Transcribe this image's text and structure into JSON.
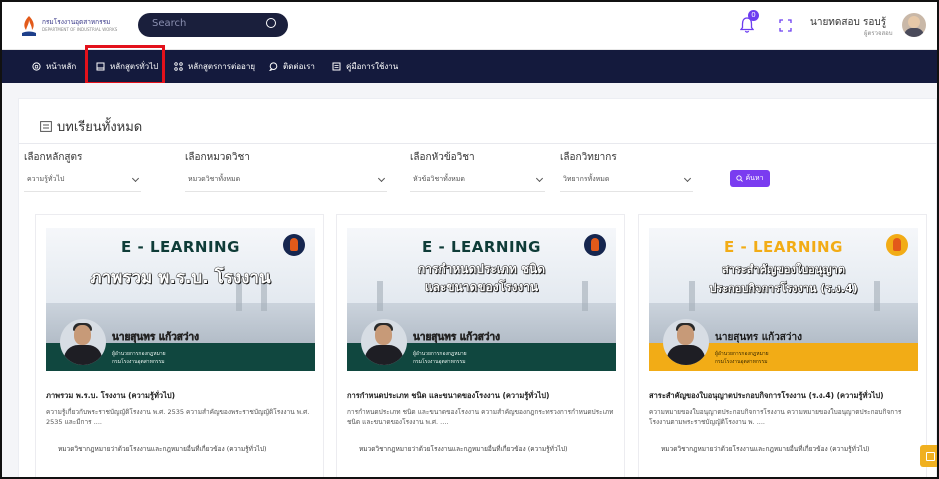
{
  "header": {
    "logo_line1": "กรมโรงงานอุตสาหกรรม",
    "logo_line2": "DEPARTMENT OF INDUSTRIAL WORKS",
    "search_placeholder": "Search",
    "notification_count": "0",
    "user_name": "นายทดสอบ รอบรู้",
    "user_role": "ผู้ตรวจสอบ"
  },
  "nav": {
    "items": [
      {
        "label": "หน้าหลัก",
        "icon": "home-icon"
      },
      {
        "label": "หลักสูตรทั่วไป",
        "icon": "book-icon"
      },
      {
        "label": "หลักสูตรการต่ออายุ",
        "icon": "network-icon"
      },
      {
        "label": "ติดต่อเรา",
        "icon": "chat-icon"
      },
      {
        "label": "คู่มือการใช้งาน",
        "icon": "manual-icon"
      }
    ]
  },
  "main": {
    "title": "บทเรียนทั้งหมด",
    "filters": [
      {
        "label": "เลือกหลักสูตร",
        "value": "ความรู้ทั่วไป"
      },
      {
        "label": "เลือกหมวดวิชา",
        "value": "หมวดวิชาทั้งหมด"
      },
      {
        "label": "เลือกหัวข้อวิชา",
        "value": "หัวข้อวิชาทั้งหมด"
      },
      {
        "label": "เลือกวิทยากร",
        "value": "วิทยากรทั้งหมด"
      }
    ],
    "search_button": "ค้นหา",
    "cards": [
      {
        "thumb_heading": "E - LEARNING",
        "thumb_title_1": "ภาพรวม พ.ร.บ. โรงงาน",
        "thumb_title_2": "",
        "presenter": "นายสุนทร แก้วสว่าง",
        "presenter_role_1": "ผู้อำนวยการกองกฎหมาย",
        "presenter_role_2": "กรมโรงงานอุตสาหกรรม",
        "title": "ภาพรวม พ.ร.บ. โรงงาน (ความรู้ทั่วไป)",
        "desc": "ความรู้เกี่ยวกับพระราชบัญญัติโรงงาน พ.ศ. 2535   ความสำคัญของพระราชบัญญัติโรงงาน พ.ศ. 2535 และมีการ ....",
        "category": "หมวดวิชากฎหมายว่าด้วยโรงงานและกฎหมายอื่นที่เกี่ยวข้อง (ความรู้ทั่วไป)",
        "band_color": "#10473f"
      },
      {
        "thumb_heading": "E - LEARNING",
        "thumb_title_1": "การกำหนดประเภท ชนิด",
        "thumb_title_2": "และขนาดของโรงงาน",
        "presenter": "นายสุนทร แก้วสว่าง",
        "presenter_role_1": "ผู้อำนวยการกองกฎหมาย",
        "presenter_role_2": "กรมโรงงานอุตสาหกรรม",
        "title": "การกำหนดประเภท ชนิด และขนาดของโรงงาน (ความรู้ทั่วไป)",
        "desc": "การกำหนดประเภท ชนิด และขนาดของโรงงาน ความสำคัญของกฎกระทรวงการกำหนดประเภท ชนิด และขนาดของโรงงาน พ.ศ. ....",
        "category": "หมวดวิชากฎหมายว่าด้วยโรงงานและกฎหมายอื่นที่เกี่ยวข้อง (ความรู้ทั่วไป)",
        "band_color": "#10473f"
      },
      {
        "thumb_heading": "E - LEARNING",
        "thumb_title_1": "สาระสำคัญของใบอนุญาต",
        "thumb_title_2": "ประกอบกิจการโรงงาน (ร.ง.4)",
        "presenter": "นายสุนทร แก้วสว่าง",
        "presenter_role_1": "ผู้อำนวยการกองกฎหมาย",
        "presenter_role_2": "กรมโรงงานอุตสาหกรรม",
        "title": "สาระสำคัญของใบอนุญาตประกอบกิจการโรงงาน (ร.ง.4) (ความรู้ทั่วไป)",
        "desc": "ความหมายของใบอนุญาตประกอบกิจการโรงงาน ความหมายของใบอนุญาตประกอบกิจการโรงงานตามพระราชบัญญัติโรงงาน พ. ....",
        "category": "หมวดวิชากฎหมายว่าด้วยโรงงานและกฎหมายอื่นที่เกี่ยวข้อง (ความรู้ทั่วไป)",
        "band_color": "#f2ac16"
      }
    ]
  },
  "colors": {
    "nav_bg": "#141a3d",
    "accent": "#7a3cf0",
    "highlight": "#e3111b"
  }
}
